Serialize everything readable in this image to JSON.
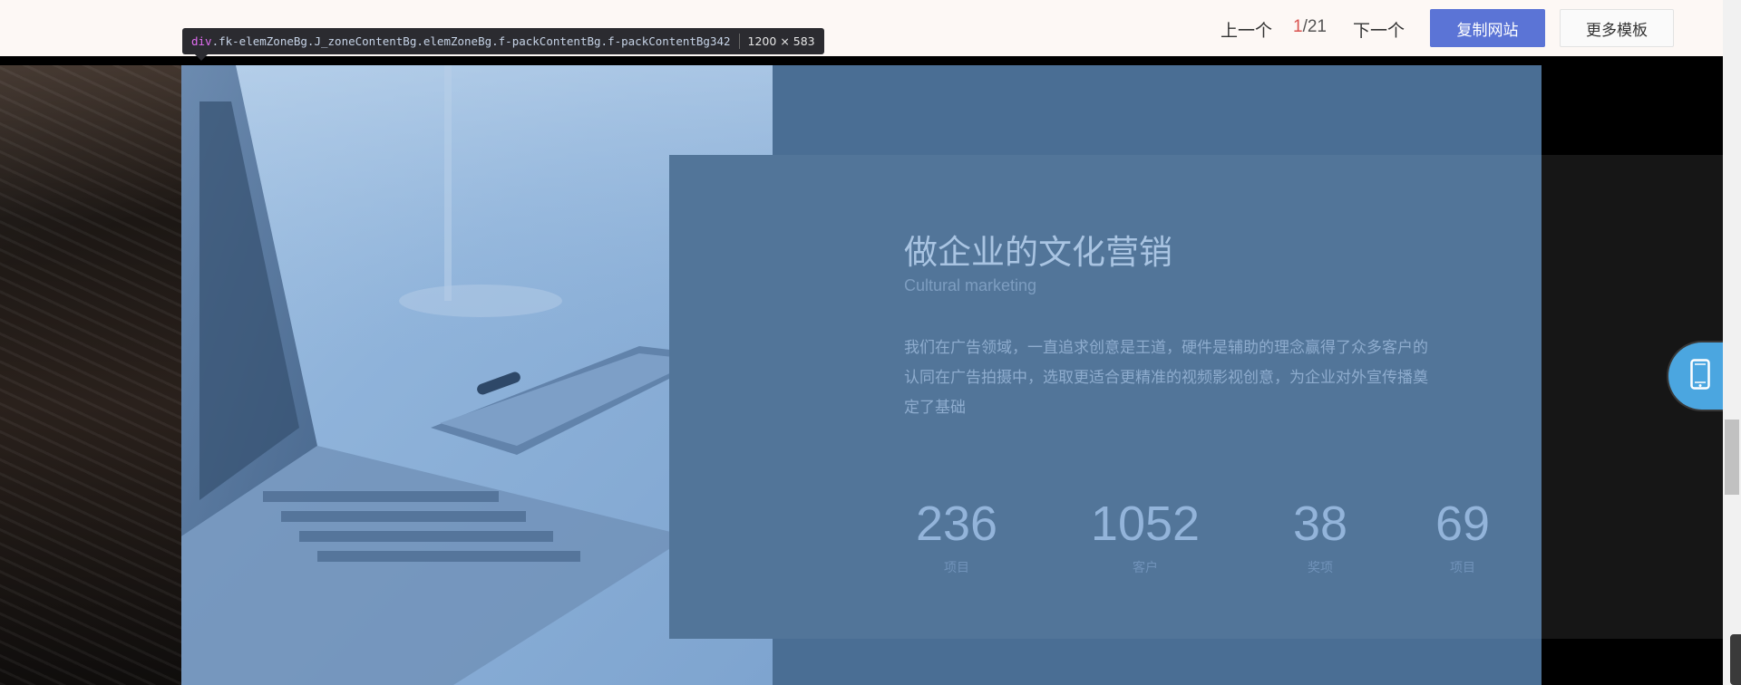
{
  "toolbar": {
    "prev_label": "上一个",
    "page_current": "1",
    "page_total": "/21",
    "next_label": "下一个",
    "copy_label": "复制网站",
    "more_label": "更多模板"
  },
  "devtools": {
    "tag": "div",
    "classes": ".fk-elemZoneBg.J_zoneContentBg.elemZoneBg.f-packContentBg.f-packContentBg342",
    "dimensions": "1200 × 583"
  },
  "card": {
    "title": "做企业的文化营销",
    "subtitle": "Cultural marketing",
    "description": "我们在广告领域，一直追求创意是王道，硬件是辅助的理念赢得了众多客户的认同在广告拍摄中，选取更适合更精准的视频影视创意，为企业对外宣传播奠定了基础"
  },
  "stats": [
    {
      "value": "236",
      "label": "项目"
    },
    {
      "value": "1052",
      "label": "客户"
    },
    {
      "value": "38",
      "label": "奖项"
    },
    {
      "value": "69",
      "label": "项目"
    }
  ],
  "colors": {
    "zone_bg": "#4a6e94",
    "card_bg": "#527599",
    "accent_button": "#5b74d6",
    "page_counter_current": "#d9534f",
    "phone_button": "#4ba6e0"
  },
  "icons": {
    "phone": "mobile-phone-icon"
  }
}
